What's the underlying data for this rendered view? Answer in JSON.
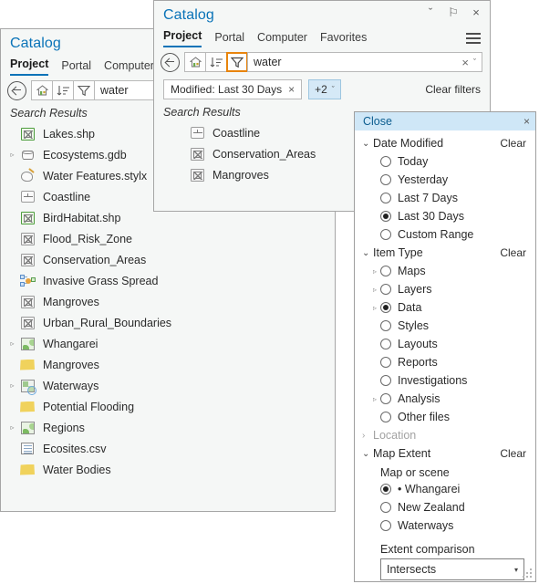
{
  "left_panel": {
    "title": "Catalog",
    "tabs": [
      {
        "label": "Project",
        "active": true
      },
      {
        "label": "Portal",
        "active": false
      },
      {
        "label": "Computer",
        "active": false
      }
    ],
    "toolbar": {
      "back_icon": "back-arrow-icon",
      "home_icon": "home-icon",
      "sort_icon": "sort-icon",
      "filter_icon": "filter-funnel-icon",
      "search_value": "water"
    },
    "results_header": "Search Results",
    "items": [
      {
        "label": "Lakes.shp",
        "icon": "shapefile-icon",
        "expandable": false,
        "indent": 1
      },
      {
        "label": "Ecosystems.gdb",
        "icon": "geodatabase-icon",
        "expandable": true,
        "indent": 1
      },
      {
        "label": "Water Features.stylx",
        "icon": "style-icon",
        "expandable": false,
        "indent": 1
      },
      {
        "label": "Coastline",
        "icon": "feature-class-icon",
        "expandable": false,
        "indent": 1
      },
      {
        "label": "BirdHabitat.shp",
        "icon": "shapefile-icon",
        "expandable": false,
        "indent": 1
      },
      {
        "label": "Flood_Risk_Zone",
        "icon": "table-icon",
        "expandable": false,
        "indent": 1
      },
      {
        "label": "Conservation_Areas",
        "icon": "table-icon",
        "expandable": false,
        "indent": 1
      },
      {
        "label": "Invasive Grass Spread",
        "icon": "network-diagram-icon",
        "expandable": false,
        "indent": 1
      },
      {
        "label": "Mangroves",
        "icon": "table-icon",
        "expandable": false,
        "indent": 1
      },
      {
        "label": "Urban_Rural_Boundaries",
        "icon": "table-icon",
        "expandable": false,
        "indent": 1
      },
      {
        "label": "Whangarei",
        "icon": "map-icon",
        "expandable": true,
        "indent": 1
      },
      {
        "label": "Mangroves",
        "icon": "folder-icon",
        "expandable": false,
        "indent": 1
      },
      {
        "label": "Waterways",
        "icon": "map-layer-icon",
        "expandable": true,
        "indent": 1
      },
      {
        "label": "Potential Flooding",
        "icon": "folder-icon",
        "expandable": false,
        "indent": 1
      },
      {
        "label": "Regions",
        "icon": "map-icon",
        "expandable": true,
        "indent": 1
      },
      {
        "label": "Ecosites.csv",
        "icon": "csv-icon",
        "expandable": false,
        "indent": 1
      },
      {
        "label": "Water Bodies",
        "icon": "folder-icon",
        "expandable": false,
        "indent": 1
      }
    ]
  },
  "center_panel": {
    "title": "Catalog",
    "caption_buttons": [
      {
        "name": "chevron-down-icon",
        "glyph": "ˇ"
      },
      {
        "name": "pin-icon",
        "glyph": "⚐"
      },
      {
        "name": "close-icon",
        "glyph": "×"
      }
    ],
    "tabs": [
      {
        "label": "Project",
        "active": true
      },
      {
        "label": "Portal",
        "active": false
      },
      {
        "label": "Computer",
        "active": false
      },
      {
        "label": "Favorites",
        "active": false
      }
    ],
    "menu_icon": "hamburger-menu-icon",
    "toolbar": {
      "back_icon": "back-arrow-icon",
      "home_icon": "home-icon",
      "sort_icon": "sort-icon",
      "filter_icon": "filter-funnel-icon",
      "filter_active": true,
      "search_value": "water",
      "clear_glyph": "×",
      "dropdown_glyph": "ˇ"
    },
    "chips": {
      "modified_label": "Modified: Last 30 Days",
      "modified_close": "×",
      "more_label": "+2",
      "more_caret": "ˇ",
      "clear_filters": "Clear filters"
    },
    "results_header": "Search Results",
    "items": [
      {
        "label": "Coastline",
        "icon": "feature-class-icon"
      },
      {
        "label": "Conservation_Areas",
        "icon": "table-icon"
      },
      {
        "label": "Mangroves",
        "icon": "table-icon"
      }
    ]
  },
  "filter_flyout": {
    "header": {
      "title": "Close",
      "close_glyph": "×",
      "bg": "#cfe7f7",
      "fg": "#0c5d8f"
    },
    "groups": [
      {
        "name": "Date Modified",
        "label": "Date Modified",
        "clear": "Clear",
        "expanded": true,
        "dimmed": false,
        "options": [
          {
            "label": "Today",
            "selected": false,
            "expandable": false
          },
          {
            "label": "Yesterday",
            "selected": false,
            "expandable": false
          },
          {
            "label": "Last 7 Days",
            "selected": false,
            "expandable": false
          },
          {
            "label": "Last 30 Days",
            "selected": true,
            "expandable": false
          },
          {
            "label": "Custom Range",
            "selected": false,
            "expandable": false
          }
        ]
      },
      {
        "name": "Item Type",
        "label": "Item Type",
        "clear": "Clear",
        "expanded": true,
        "dimmed": false,
        "options": [
          {
            "label": "Maps",
            "selected": false,
            "expandable": true
          },
          {
            "label": "Layers",
            "selected": false,
            "expandable": true
          },
          {
            "label": "Data",
            "selected": true,
            "expandable": true
          },
          {
            "label": "Styles",
            "selected": false,
            "expandable": false
          },
          {
            "label": "Layouts",
            "selected": false,
            "expandable": false
          },
          {
            "label": "Reports",
            "selected": false,
            "expandable": false
          },
          {
            "label": "Investigations",
            "selected": false,
            "expandable": false
          },
          {
            "label": "Analysis",
            "selected": false,
            "expandable": true
          },
          {
            "label": "Other files",
            "selected": false,
            "expandable": false
          }
        ]
      },
      {
        "name": "Location",
        "label": "Location",
        "clear": "",
        "expanded": false,
        "dimmed": true,
        "options": []
      },
      {
        "name": "Map Extent",
        "label": "Map Extent",
        "clear": "Clear",
        "expanded": true,
        "dimmed": false,
        "sublabel": "Map or scene",
        "options": [
          {
            "label": "• Whangarei",
            "selected": true,
            "expandable": false
          },
          {
            "label": "New Zealand",
            "selected": false,
            "expandable": false
          },
          {
            "label": "Waterways",
            "selected": false,
            "expandable": false
          }
        ],
        "extent_comparison_label": "Extent comparison",
        "extent_comparison_value": "Intersects",
        "extent_comparison_caret": "▾"
      }
    ]
  },
  "colors": {
    "accent_blue": "#0a73b8",
    "panel_bg": "#f5f7f6",
    "highlight_orange": "#e8840c",
    "chip_blue": "#d5e9f7",
    "flyout_header": "#cfe7f7"
  }
}
